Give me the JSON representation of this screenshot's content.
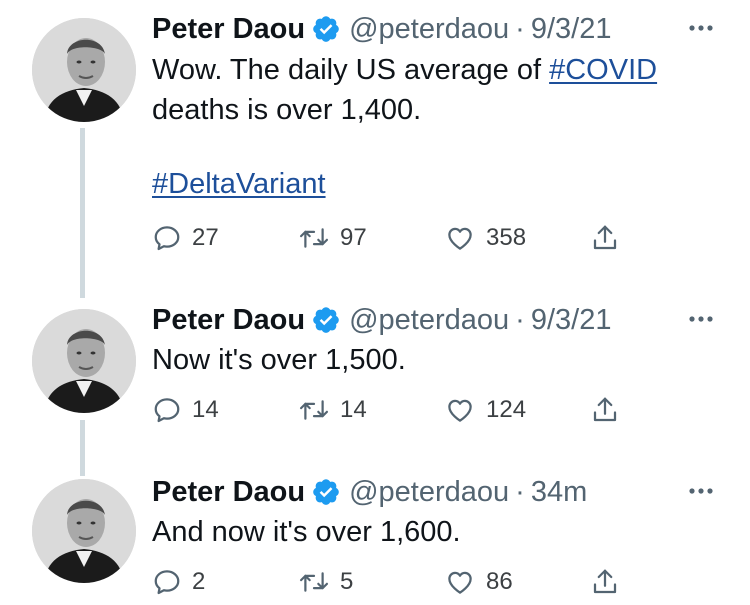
{
  "tweets": [
    {
      "author": {
        "name": "Peter Daou",
        "handle": "@peterdaou",
        "verified": true
      },
      "separator": "·",
      "time": "9/3/21",
      "text_before": "Wow. The daily US average of ",
      "hashtag_inline": "#COVID",
      "text_after": "\ndeaths is over 1,400.",
      "hashtag_block": "#DeltaVariant",
      "stats": {
        "replies": "27",
        "retweets": "97",
        "likes": "358"
      }
    },
    {
      "author": {
        "name": "Peter Daou",
        "handle": "@peterdaou",
        "verified": true
      },
      "separator": "·",
      "time": "9/3/21",
      "text": "Now it's over 1,500.",
      "stats": {
        "replies": "14",
        "retweets": "14",
        "likes": "124"
      }
    },
    {
      "author": {
        "name": "Peter Daou",
        "handle": "@peterdaou",
        "verified": true
      },
      "separator": "·",
      "time": "34m",
      "text": "And now it's over 1,600.",
      "stats": {
        "replies": "2",
        "retweets": "5",
        "likes": "86"
      }
    }
  ],
  "icons": {
    "reply": "reply-icon",
    "retweet": "retweet-icon",
    "like": "heart-icon",
    "share": "share-icon",
    "more": "more-icon",
    "verified": "verified-badge-icon"
  },
  "colors": {
    "text": "#0f1419",
    "secondary": "#536471",
    "hashtag": "#1d4f9a",
    "verified": "#1d9bf0",
    "thread_line": "#cfd9de"
  }
}
